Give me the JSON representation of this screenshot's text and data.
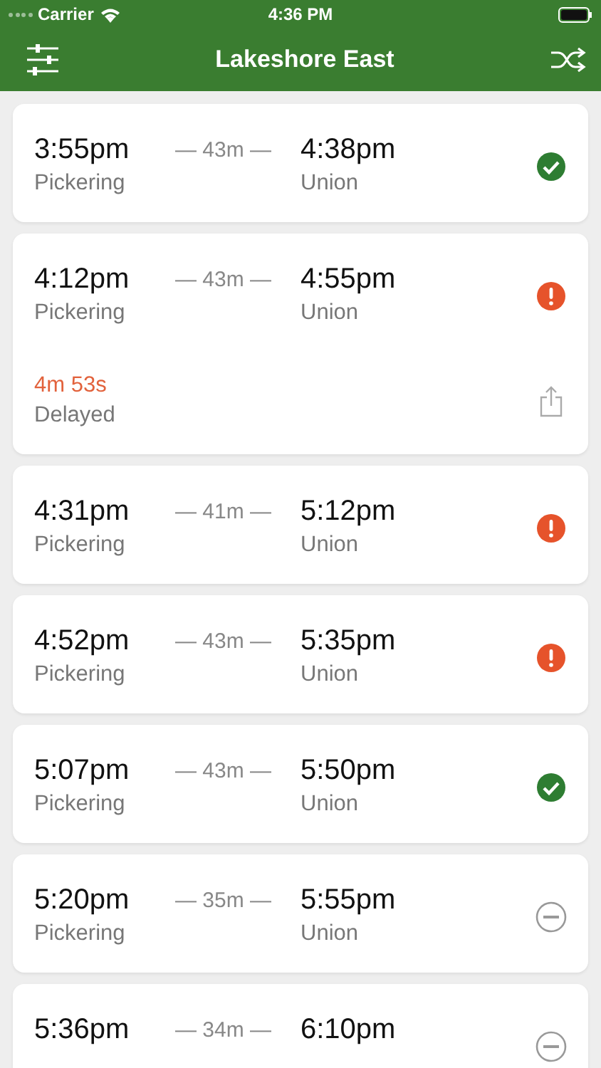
{
  "status_bar": {
    "carrier": "Carrier",
    "time": "4:36 PM"
  },
  "nav": {
    "title": "Lakeshore East"
  },
  "trips": [
    {
      "depart": "3:55pm",
      "from": "Pickering",
      "duration": "— 43m —",
      "arrive": "4:38pm",
      "to": "Union",
      "kind": "ok",
      "expanded": false
    },
    {
      "depart": "4:12pm",
      "from": "Pickering",
      "duration": "— 43m —",
      "arrive": "4:55pm",
      "to": "Union",
      "kind": "delayed",
      "expanded": true,
      "delay": "4m 53s",
      "delay_label": "Delayed"
    },
    {
      "depart": "4:31pm",
      "from": "Pickering",
      "duration": "— 41m —",
      "arrive": "5:12pm",
      "to": "Union",
      "kind": "delayed",
      "expanded": false
    },
    {
      "depart": "4:52pm",
      "from": "Pickering",
      "duration": "— 43m —",
      "arrive": "5:35pm",
      "to": "Union",
      "kind": "delayed",
      "expanded": false
    },
    {
      "depart": "5:07pm",
      "from": "Pickering",
      "duration": "— 43m —",
      "arrive": "5:50pm",
      "to": "Union",
      "kind": "ok",
      "expanded": false
    },
    {
      "depart": "5:20pm",
      "from": "Pickering",
      "duration": "— 35m —",
      "arrive": "5:55pm",
      "to": "Union",
      "kind": "cancelled",
      "expanded": false
    },
    {
      "depart": "5:36pm",
      "duration": "— 34m —",
      "arrive": "6:10pm",
      "kind": "cancelled",
      "expanded": false
    }
  ]
}
